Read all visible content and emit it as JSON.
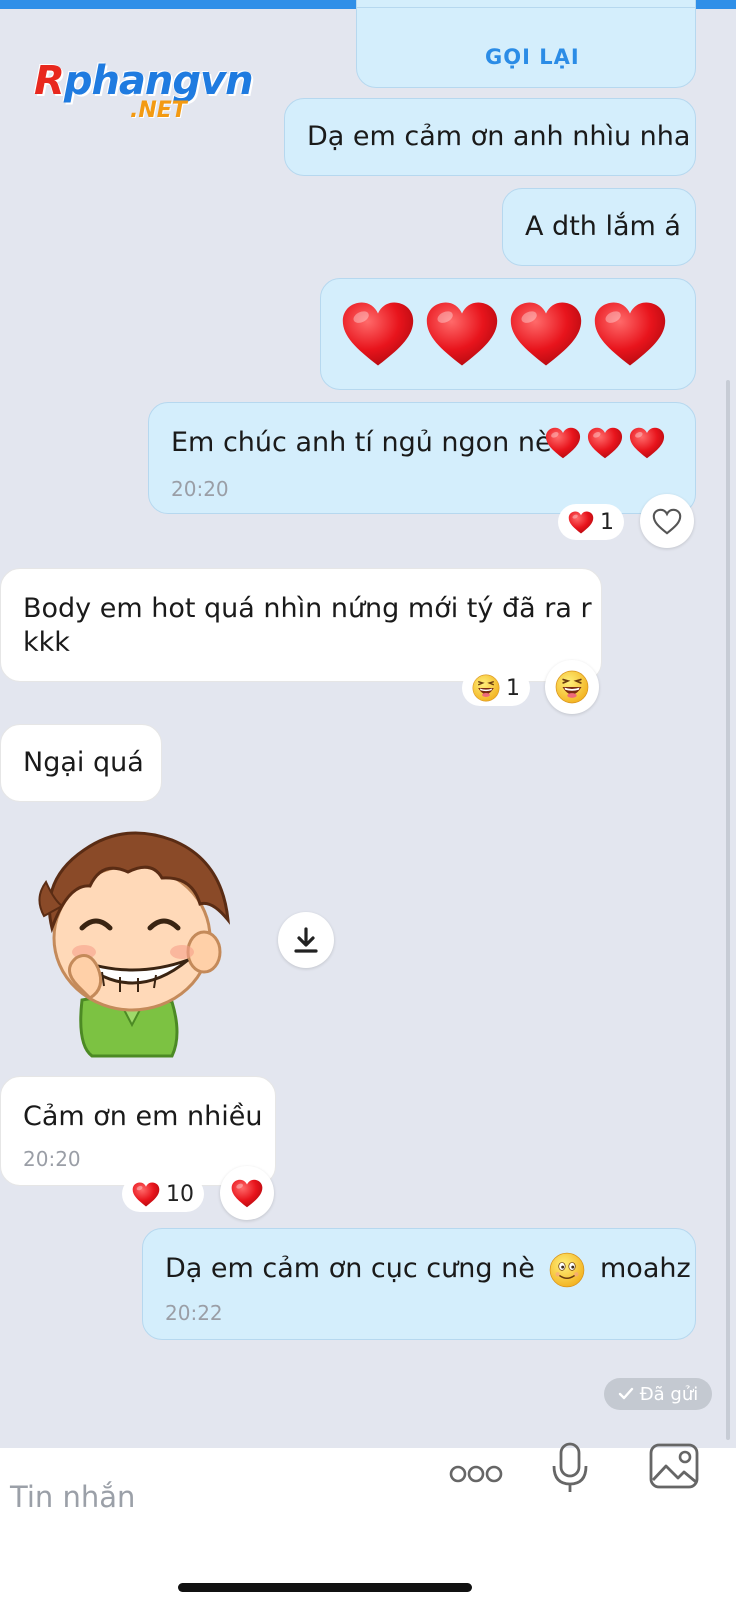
{
  "watermark": {
    "brand": "Rphangvn",
    "brand_a": "R",
    "brand_b": "phangvn",
    "suffix": ".NET"
  },
  "call_card": {
    "button_label": "GỌI LẠI"
  },
  "messages": [
    {
      "id": "m1",
      "direction": "outgoing",
      "text": "Dạ em cảm ơn anh nhìu nha"
    },
    {
      "id": "m2",
      "direction": "outgoing",
      "text": "A dth lắm á"
    },
    {
      "id": "m3",
      "direction": "outgoing",
      "emoji": "heart",
      "count": 4
    },
    {
      "id": "m4",
      "direction": "outgoing",
      "text": "Em chúc anh tí ngủ ngon nè",
      "trailing_emoji": "heart x3",
      "time": "20:20",
      "reaction": {
        "emoji": "heart",
        "count": "1"
      }
    },
    {
      "id": "m5",
      "direction": "incoming",
      "text_line1": "Body em hot quá nhìn nứng mới tý đã ra r",
      "text_line2": "kkk",
      "reaction": {
        "emoji": "laughing-face",
        "count": "1"
      }
    },
    {
      "id": "m6",
      "direction": "incoming",
      "text": "Ngại quá"
    },
    {
      "id": "m7",
      "direction": "incoming",
      "type": "sticker",
      "sticker": "grinning-boy-sticker"
    },
    {
      "id": "m8",
      "direction": "incoming",
      "text": "Cảm ơn em nhiều",
      "time": "20:20",
      "reaction": {
        "emoji": "heart",
        "count": "10"
      }
    },
    {
      "id": "m9",
      "direction": "outgoing",
      "text_a": "Dạ em cảm ơn cục cưng nè",
      "emoji": "smiling-face",
      "text_b": "moahz",
      "time": "20:22"
    }
  ],
  "status": {
    "label": "Đã gửi"
  },
  "composer": {
    "placeholder": "Tin nhắn",
    "icons": [
      "more-icon",
      "microphone-icon",
      "image-icon"
    ]
  },
  "colors": {
    "outgoing_bubble": "#d4eefc",
    "incoming_bubble": "#ffffff",
    "background": "#e3e6ef",
    "accent": "#2b8ce6"
  }
}
